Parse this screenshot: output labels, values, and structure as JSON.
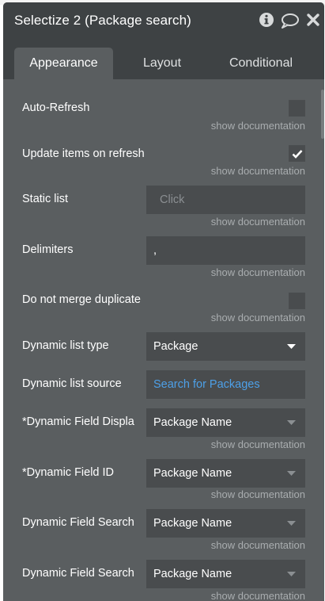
{
  "window": {
    "title": "Selectize 2 (Package search)",
    "icons": [
      "info-icon",
      "chat-icon",
      "close-icon"
    ]
  },
  "tabs": [
    {
      "label": "Appearance",
      "active": true
    },
    {
      "label": "Layout",
      "active": false
    },
    {
      "label": "Conditional",
      "active": false
    }
  ],
  "doc_link": "show documentation",
  "properties": {
    "auto_refresh": {
      "label": "Auto-Refresh",
      "checked": false
    },
    "update_items": {
      "label": "Update items on refresh",
      "checked": true
    },
    "static_list": {
      "label": "Static list",
      "placeholder": "Click"
    },
    "delimiters": {
      "label": "Delimiters",
      "value": ","
    },
    "no_merge": {
      "label": "Do not merge duplicate",
      "checked": false
    },
    "dynamic_type": {
      "label": "Dynamic list type",
      "value": "Package"
    },
    "dynamic_source": {
      "label": "Dynamic list source",
      "value": "Search for Packages"
    },
    "field_display": {
      "label": "*Dynamic Field Displa",
      "value": "Package Name"
    },
    "field_id": {
      "label": "*Dynamic Field ID",
      "value": "Package Name"
    },
    "field_search_1": {
      "label": "Dynamic Field Search",
      "value": "Package Name"
    },
    "field_search_2": {
      "label": "Dynamic Field Search",
      "value": "Package Name"
    }
  },
  "colors": {
    "panel": "#5a5e60",
    "header": "#3e4244",
    "field": "#494c4e",
    "link": "#4da0e8"
  }
}
